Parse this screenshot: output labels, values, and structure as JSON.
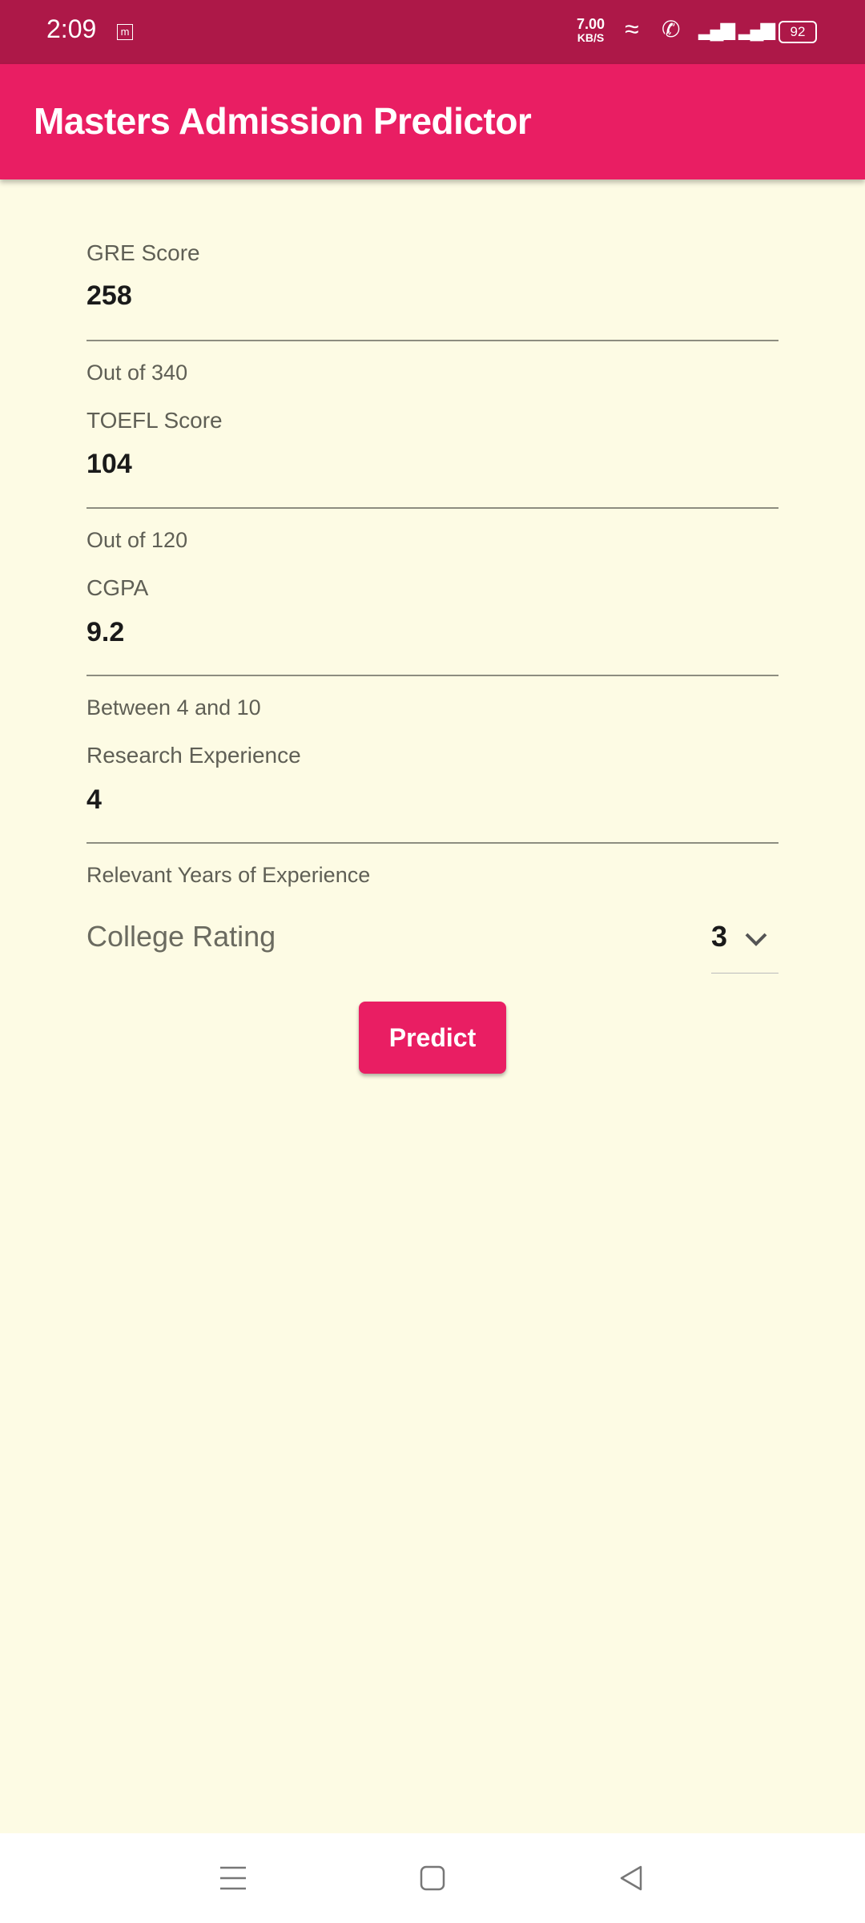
{
  "status_bar": {
    "time": "2:09",
    "net_speed": "7.00",
    "net_unit": "KB/S",
    "battery": "92"
  },
  "app_bar": {
    "title": "Masters Admission Predictor"
  },
  "fields": [
    {
      "label": "GRE Score",
      "value": "258",
      "helper": "Out of 340"
    },
    {
      "label": "TOEFL Score",
      "value": "104",
      "helper": "Out of 120"
    },
    {
      "label": "CGPA",
      "value": "9.2",
      "helper": "Between 4 and 10"
    },
    {
      "label": "Research Experience",
      "value": "4",
      "helper": "Relevant Years of Experience"
    }
  ],
  "college_rating": {
    "label": "College Rating",
    "value": "3"
  },
  "predict_label": "Predict",
  "colors": {
    "primary": "#e91e63",
    "status": "#ad1848",
    "background": "#fdfbe4"
  }
}
